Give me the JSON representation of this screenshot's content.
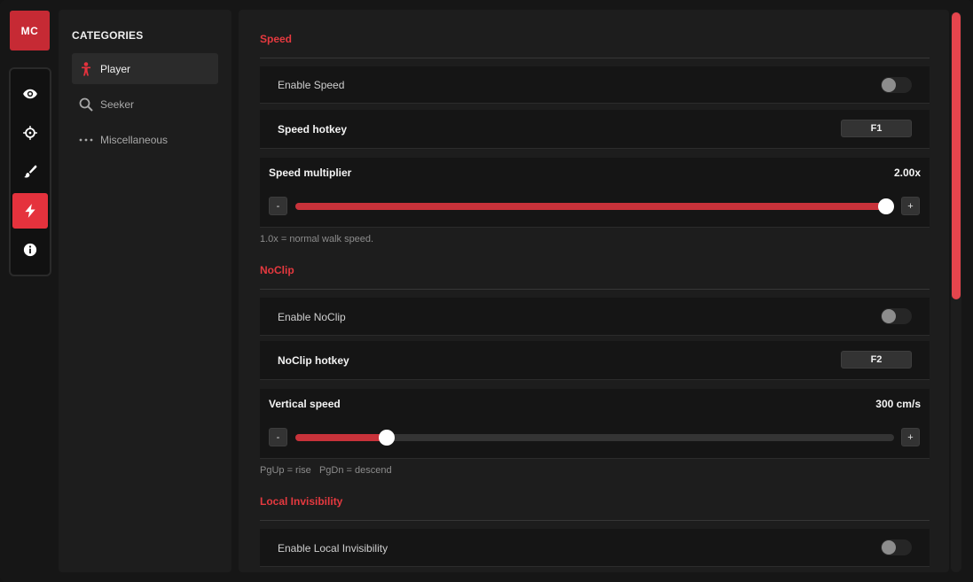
{
  "brand": {
    "logo_text": "MC",
    "accent": "#e5323d"
  },
  "rail": {
    "items": [
      {
        "icon": "eye-icon",
        "active": false
      },
      {
        "icon": "crosshair-icon",
        "active": false
      },
      {
        "icon": "brush-icon",
        "active": false
      },
      {
        "icon": "lightning-icon",
        "active": true
      },
      {
        "icon": "info-icon",
        "active": false
      }
    ]
  },
  "categories": {
    "title": "CATEGORIES",
    "items": [
      {
        "label": "Player",
        "icon": "person-icon",
        "active": true
      },
      {
        "label": "Seeker",
        "icon": "search-icon",
        "active": false
      },
      {
        "label": "Miscellaneous",
        "icon": "more-dots-icon",
        "active": false
      }
    ]
  },
  "speed": {
    "title": "Speed",
    "enable_label": "Enable Speed",
    "enabled": false,
    "hotkey_label": "Speed hotkey",
    "hotkey_value": "F1",
    "multiplier_label": "Speed multiplier",
    "multiplier_value": "2.00x",
    "multiplier_fraction": 0.986,
    "minus": "-",
    "plus": "+",
    "hint": "1.0x = normal walk speed."
  },
  "noclip": {
    "title": "NoClip",
    "enable_label": "Enable NoClip",
    "enabled": false,
    "hotkey_label": "NoClip hotkey",
    "hotkey_value": "F2",
    "vspeed_label": "Vertical speed",
    "vspeed_value": "300 cm/s",
    "vspeed_fraction": 0.152,
    "minus": "-",
    "plus": "+",
    "hint": "PgUp = rise   PgDn = descend"
  },
  "invisibility": {
    "title": "Local Invisibility",
    "enable_label": "Enable Local Invisibility",
    "enabled": false
  },
  "scroll": {
    "position_fraction": 0.0
  }
}
